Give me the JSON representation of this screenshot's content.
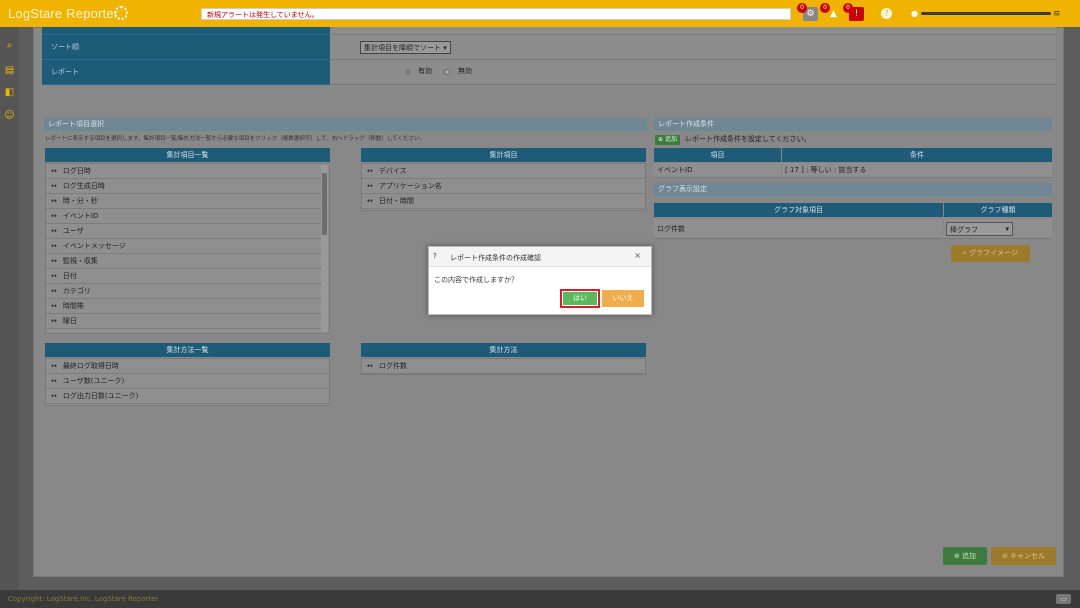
{
  "header": {
    "app_title": "LogStare Reporter",
    "alert_message": "新規アラートは発生していません。",
    "badges": [
      "0",
      "0",
      "0"
    ]
  },
  "form": {
    "sort_label": "ソート順",
    "sort_value": "集計項目を降順でソート",
    "report_label": "レポート",
    "radio_enabled": "有効",
    "radio_disabled": "無効"
  },
  "report_items": {
    "section_title": "レポート項目選択",
    "hint": "レポートに表示する項目を選択します。集計項目一覧/集計方法一覧から必要な項目をクリック（複数選択可）して、右へドラッグ（移動）してください。",
    "agg_list_title": "集計項目一覧",
    "agg_list": [
      "ログ日時",
      "ログ生成日時",
      "時・分・秒",
      "イベントID",
      "ユーザ",
      "イベントメッセージ",
      "監視・収集",
      "日付",
      "カテゴリ",
      "時間帯",
      "曜日"
    ],
    "agg_selected_title": "集計項目",
    "agg_selected": [
      "デバイス",
      "アプリケーション名",
      "日付・時間"
    ],
    "method_list_title": "集計方法一覧",
    "method_list": [
      "最終ログ取得日時",
      "ユーザ数(ユニーク)",
      "ログ出力日数(ユニーク)"
    ],
    "method_selected_title": "集計方法",
    "method_selected": [
      "ログ件数"
    ]
  },
  "conditions": {
    "section_title": "レポート作成条件",
    "add_label": "追加",
    "instruction": "レポート作成条件を設定してください。",
    "col_item": "項目",
    "col_condition": "条件",
    "row_item": "イベントID",
    "row_condition": "[ 17 ] : 等しい : 該当する"
  },
  "graph": {
    "section_title": "グラフ表示設定",
    "col_target": "グラフ対象項目",
    "col_type": "グラフ種類",
    "target": "ログ件数",
    "type": "棒グラフ",
    "image_button": "グラフイメージ"
  },
  "actions": {
    "add": "追加",
    "cancel": "キャンセル"
  },
  "footer": {
    "copyright": "Copyright: LogStare,Inc.  LogStare Reporter"
  },
  "dialog": {
    "title": "レポート作成条件の作成確認",
    "message": "この内容で作成しますか？",
    "yes": "はい",
    "no": "いいえ"
  },
  "colors": {
    "brand": "#f0b400",
    "header_blue": "#1e5b79",
    "yes_button": "#5cb85c",
    "no_button": "#f0ad4e",
    "highlight": "#d4202a"
  }
}
